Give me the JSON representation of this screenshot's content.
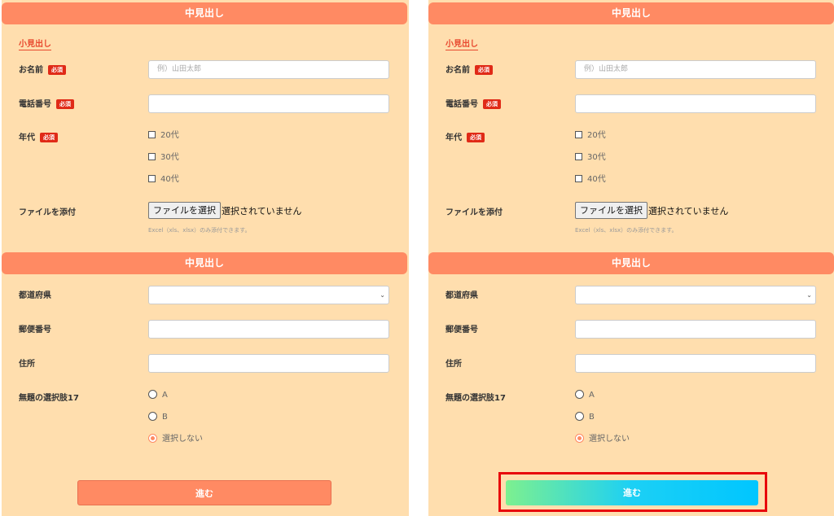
{
  "panels": [
    {
      "section1_title": "中見出し",
      "subheading": "小見出し",
      "name_label": "お名前",
      "name_required": "必須",
      "name_placeholder": "例）山田太郎",
      "phone_label": "電話番号",
      "phone_required": "必須",
      "age_label": "年代",
      "age_required": "必須",
      "age_options": [
        "20代",
        "30代",
        "40代"
      ],
      "file_label": "ファイルを添付",
      "file_button": "ファイルを選択",
      "file_status": "選択されていません",
      "file_note": "Excel（xls、xlsx）のみ添付できます。",
      "section2_title": "中見出し",
      "prefecture_label": "都道府県",
      "zip_label": "郵便番号",
      "address_label": "住所",
      "choice_label": "無題の選択肢17",
      "choice_options": [
        "A",
        "B",
        "選択しない"
      ],
      "choice_selected": "選択しない",
      "submit_label": "進む",
      "submit_color": "#ff8a63"
    },
    {
      "section1_title": "中見出し",
      "subheading": "小見出し",
      "name_label": "お名前",
      "name_required": "必須",
      "name_placeholder": "例）山田太郎",
      "phone_label": "電話番号",
      "phone_required": "必須",
      "age_label": "年代",
      "age_required": "必須",
      "age_options": [
        "20代",
        "30代",
        "40代"
      ],
      "file_label": "ファイルを添付",
      "file_button": "ファイルを選択",
      "file_status": "選択されていません",
      "file_note": "Excel（xls、xlsx）のみ添付できます。",
      "section2_title": "中見出し",
      "prefecture_label": "都道府県",
      "zip_label": "郵便番号",
      "address_label": "住所",
      "choice_label": "無題の選択肢17",
      "choice_options": [
        "A",
        "B",
        "選択しない"
      ],
      "choice_selected": "選択しない",
      "submit_label": "進む",
      "submit_gradient": [
        "#7df08f",
        "#00c6ff"
      ]
    }
  ],
  "colors": {
    "background": "#ffdeae",
    "header": "#ff8a63",
    "required_badge": "#e02a17",
    "highlight_border": "#e8070c"
  }
}
